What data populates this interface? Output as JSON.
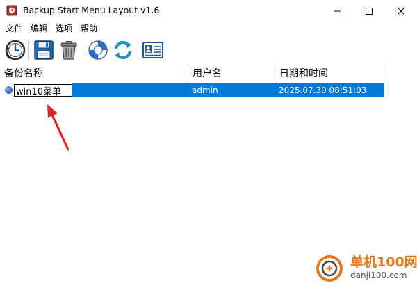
{
  "window": {
    "title": "Backup Start Menu Layout v1.6"
  },
  "menu": {
    "items": [
      "文件",
      "编辑",
      "选项",
      "帮助"
    ]
  },
  "toolbar": {
    "buttons": [
      {
        "icon": "clock-restore-icon"
      },
      {
        "icon": "floppy-save-icon"
      },
      {
        "icon": "trash-icon"
      },
      {
        "icon": "lifebuoy-icon"
      },
      {
        "icon": "refresh-icon"
      },
      {
        "icon": "contact-card-icon"
      }
    ]
  },
  "list": {
    "columns": [
      "备份名称",
      "用户名",
      "日期和时间"
    ],
    "rows": [
      {
        "name": "win10菜单",
        "user": "admin",
        "datetime": "2025.07.30 08:51:03",
        "selected": true,
        "editing": true
      }
    ]
  },
  "colors": {
    "selection": "#0078d7",
    "annotation_arrow": "#d9282c",
    "watermark": "#e07a1f"
  },
  "watermark": {
    "text": "单机100网",
    "url": "danji100.com"
  }
}
